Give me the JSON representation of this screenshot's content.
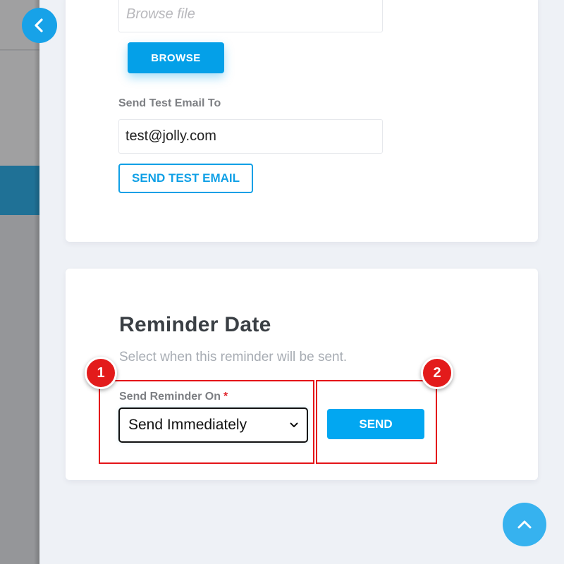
{
  "navigation": {
    "back_icon": "chevron-left-icon",
    "scroll_top_icon": "chevron-up-icon"
  },
  "file_upload": {
    "placeholder": "Browse file",
    "browse_label": "BROWSE"
  },
  "test_email": {
    "label": "Send Test Email To",
    "value": "test@jolly.com",
    "button_label": "SEND TEST EMAIL"
  },
  "reminder_date": {
    "title": "Reminder Date",
    "description": "Select when this reminder will be sent.",
    "field_label": "Send Reminder On",
    "required_mark": "*",
    "selected_option": "Send Immediately",
    "send_label": "SEND"
  },
  "annotations": [
    {
      "number": "1",
      "target": "send-reminder-on-select"
    },
    {
      "number": "2",
      "target": "send-button"
    }
  ],
  "colors": {
    "primary": "#04a0e8",
    "annotation": "#e41418",
    "active_nav": "#1f7196",
    "page_bg": "#eef1f6"
  }
}
